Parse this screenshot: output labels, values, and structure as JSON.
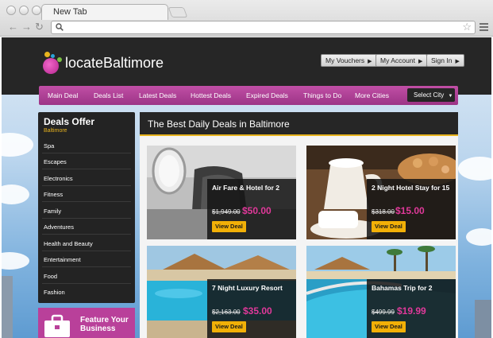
{
  "browser": {
    "tab_title": "New Tab",
    "back_icon": "back-arrow-icon",
    "forward_icon": "forward-arrow-icon",
    "reload_icon": "reload-icon",
    "url": ""
  },
  "site": {
    "logo_text": "locateBaltimore",
    "account_buttons": [
      "My Vouchers",
      "My Account",
      "Sign In"
    ]
  },
  "nav": {
    "items": [
      "Main Deal",
      "Deals List",
      "Latest Deals",
      "Hottest Deals",
      "Expired Deals",
      "Things to Do",
      "More Cities"
    ],
    "select_city": "Select City"
  },
  "sidebar": {
    "title": "Deals Offer",
    "subtitle": "Baltimore",
    "categories": [
      "Spa",
      "Escapes",
      "Electronics",
      "Fitness",
      "Family",
      "Adventures",
      "Health and Beauty",
      "Entertainment",
      "Food",
      "Fashion"
    ],
    "feature_text": "Feature Your Business"
  },
  "main": {
    "title": "The Best Daily Deals in Baltimore",
    "deals": [
      {
        "name": "Air Fare & Hotel for 2",
        "old_price": "$1,949.00",
        "new_price": "$50.00",
        "button": "View Deal"
      },
      {
        "name": "2 Night Hotel Stay for 15",
        "old_price": "$318.00",
        "new_price": "$15.00",
        "button": "View Deal"
      },
      {
        "name": "7 Night Luxury Resort",
        "old_price": "$2,163.00",
        "new_price": "$35.00",
        "button": "View Deal"
      },
      {
        "name": "Bahamas Trip for 2",
        "old_price": "$499.99",
        "new_price": "$19.99",
        "button": "View Deal"
      }
    ]
  },
  "colors": {
    "accent_magenta": "#b9409a",
    "accent_gold": "#f2b007",
    "price_pink": "#e0399a",
    "header_dark": "#262626"
  }
}
